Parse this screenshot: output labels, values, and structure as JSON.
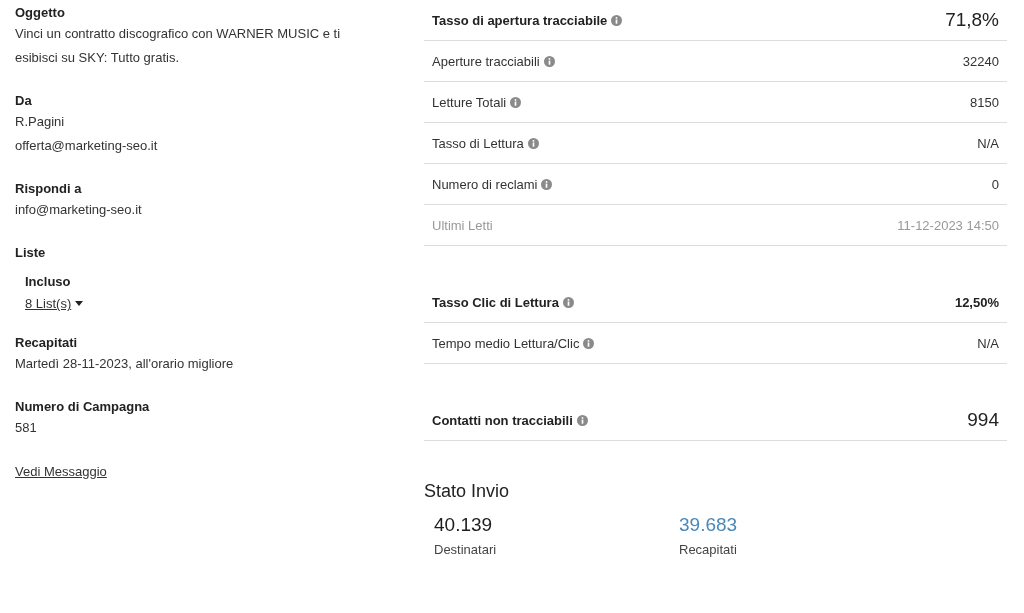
{
  "details": [
    {
      "label": "Oggetto",
      "lines": [
        "Vinci un contratto discografico con WARNER MUSIC e ti esibisci su SKY: Tutto gratis."
      ]
    },
    {
      "label": "Da",
      "lines": [
        "R.Pagini",
        "offerta@marketing-seo.it"
      ]
    },
    {
      "label": "Rispondi a",
      "lines": [
        "info@marketing-seo.it"
      ]
    },
    {
      "label": "Liste",
      "sub": {
        "label": "Incluso",
        "link": "8 List(s)"
      }
    },
    {
      "label": "Recapitati",
      "lines": [
        "Martedì 28-11-2023, all'orario migliore"
      ]
    },
    {
      "label": "Numero di Campagna",
      "lines": [
        "581"
      ]
    }
  ],
  "view_link": "Vedi Messaggio",
  "stat_groups": [
    [
      {
        "kind": "headline",
        "label": "Tasso di apertura tracciabile",
        "info": true,
        "value": "71,8%"
      },
      {
        "kind": "normal",
        "label": "Aperture tracciabili",
        "info": true,
        "value": "32240"
      },
      {
        "kind": "normal",
        "label": "Letture Totali",
        "info": true,
        "value": "8150"
      },
      {
        "kind": "normal",
        "label": "Tasso di Lettura",
        "info": true,
        "value": "N/A"
      },
      {
        "kind": "normal",
        "label": "Numero di reclami",
        "info": true,
        "value": "0"
      },
      {
        "kind": "muted",
        "label": "Ultimi Letti",
        "info": false,
        "value": "11-12-2023 14:50"
      }
    ],
    [
      {
        "kind": "bold",
        "label": "Tasso Clic di Lettura",
        "info": true,
        "value": "12,50%"
      },
      {
        "kind": "normal",
        "label": "Tempo medio Lettura/Clic",
        "info": true,
        "value": "N/A"
      }
    ],
    [
      {
        "kind": "headline",
        "label": "Contatti non tracciabili",
        "info": true,
        "value": "994"
      }
    ]
  ],
  "send_status": {
    "title": "Stato Invio",
    "figures": [
      {
        "value": "40.139",
        "label": "Destinatari",
        "color": "#1e1e1e"
      },
      {
        "value": "39.683",
        "label": "Recapitati",
        "color": "#4a88b8"
      }
    ]
  }
}
